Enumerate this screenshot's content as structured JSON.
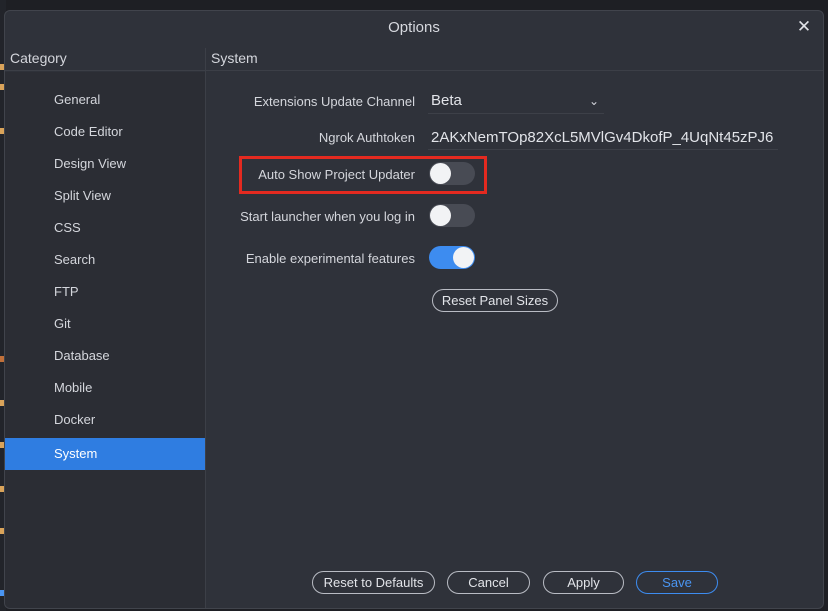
{
  "window": {
    "title": "Options",
    "close_label": "✕"
  },
  "header": {
    "category_label": "Category",
    "section_label": "System"
  },
  "sidebar": {
    "items": [
      {
        "label": "General"
      },
      {
        "label": "Code Editor"
      },
      {
        "label": "Design View"
      },
      {
        "label": "Split View"
      },
      {
        "label": "CSS"
      },
      {
        "label": "Search"
      },
      {
        "label": "FTP"
      },
      {
        "label": "Git"
      },
      {
        "label": "Database"
      },
      {
        "label": "Mobile"
      },
      {
        "label": "Docker"
      },
      {
        "label": "System",
        "active": true
      }
    ]
  },
  "settings": {
    "update_channel": {
      "label": "Extensions Update Channel",
      "value": "Beta",
      "chevron": "⌄"
    },
    "ngrok": {
      "label": "Ngrok Authtoken",
      "value": "2AKxNemTOp82XcL5MVlGv4DkofP_4UqNt45zPJ6"
    },
    "auto_show_updater": {
      "label": "Auto Show Project Updater",
      "enabled": false
    },
    "start_launcher": {
      "label": "Start launcher when you log in",
      "enabled": false
    },
    "experimental": {
      "label": "Enable experimental features",
      "enabled": true
    },
    "reset_panel_sizes": "Reset Panel Sizes"
  },
  "footer": {
    "reset_defaults": "Reset to Defaults",
    "cancel": "Cancel",
    "apply": "Apply",
    "save": "Save"
  },
  "colors": {
    "accent": "#2f7de1",
    "toggle_on": "#3d8cf0",
    "highlight": "#e42a20",
    "window_bg": "#2f323a",
    "sidebar_bg": "#2b2d34"
  }
}
